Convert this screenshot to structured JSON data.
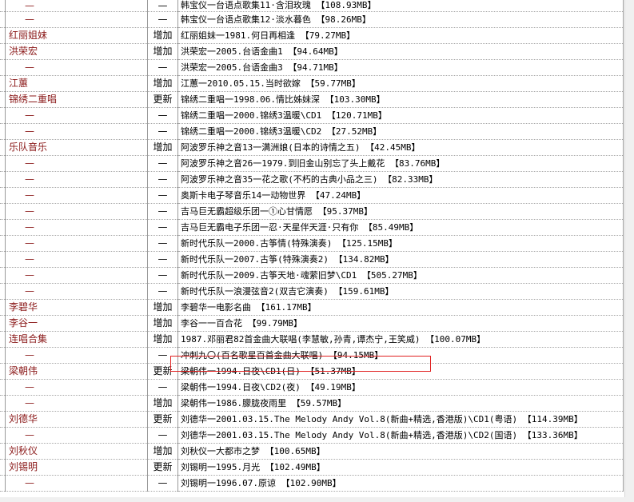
{
  "rows": [
    {
      "artist": "—",
      "action": "—",
      "text": "韩宝仪一台语点歌集11·含泪玫瑰  【108.93MB】"
    },
    {
      "artist": "—",
      "action": "—",
      "text": "韩宝仪一台语点歌集12·淡水暮色  【98.26MB】"
    },
    {
      "artist": "红丽姐妹",
      "action": "增加",
      "text": "红丽姐妹一1981.何日再相逢  【79.27MB】"
    },
    {
      "artist": "洪荣宏",
      "action": "增加",
      "text": "洪荣宏一2005.台语金曲1  【94.64MB】"
    },
    {
      "artist": "—",
      "action": "—",
      "text": "洪荣宏一2005.台语金曲3  【94.71MB】"
    },
    {
      "artist": "江蕙",
      "action": "增加",
      "text": "江蕙一2010.05.15.当时欲嫁  【59.77MB】"
    },
    {
      "artist": "锦绣二重唱",
      "action": "更新",
      "text": "锦绣二重唱一1998.06.情比姊妹深  【103.30MB】"
    },
    {
      "artist": "—",
      "action": "—",
      "text": "锦绣二重唱一2000.锦绣3温暖\\CD1  【120.71MB】"
    },
    {
      "artist": "—",
      "action": "—",
      "text": "锦绣二重唱一2000.锦绣3温暖\\CD2  【27.52MB】"
    },
    {
      "artist": "乐队音乐",
      "action": "增加",
      "text": "阿波罗乐神之音13一满洲娘(日本的诗情之五)  【42.45MB】"
    },
    {
      "artist": "—",
      "action": "—",
      "text": "阿波罗乐神之音26一1979.到旧金山别忘了头上戴花  【83.76MB】"
    },
    {
      "artist": "—",
      "action": "—",
      "text": "阿波罗乐神之音35一花之歌(不朽的古典小品之三)  【82.33MB】"
    },
    {
      "artist": "—",
      "action": "—",
      "text": "奥斯卡电子琴音乐14一动物世界  【47.24MB】"
    },
    {
      "artist": "—",
      "action": "—",
      "text": "吉马巨无霸超级乐团一①心甘情愿  【95.37MB】"
    },
    {
      "artist": "—",
      "action": "—",
      "text": "吉马巨无霸电子乐团一忍·天星伴天涯·只有你  【85.49MB】"
    },
    {
      "artist": "—",
      "action": "—",
      "text": "新时代乐队一2000.古筝情(特殊演奏)  【125.15MB】"
    },
    {
      "artist": "—",
      "action": "—",
      "text": "新时代乐队一2007.古筝(特殊演奏2)  【134.82MB】"
    },
    {
      "artist": "—",
      "action": "—",
      "text": "新时代乐队一2009.古筝天地·魂萦旧梦\\CD1  【505.27MB】"
    },
    {
      "artist": "—",
      "action": "—",
      "text": "新时代乐队一浪漫弦音2(双吉它演奏)  【159.61MB】"
    },
    {
      "artist": "李碧华",
      "action": "增加",
      "text": "李碧华一电影名曲  【161.17MB】"
    },
    {
      "artist": "李谷一",
      "action": "增加",
      "text": "李谷一一百合花  【99.79MB】"
    },
    {
      "artist": "连唱合集",
      "action": "增加",
      "text": "1987.邓丽君82首金曲大联唱(李慧敏,孙青,谭杰宁,王笑威)  【100.07MB】"
    },
    {
      "artist": "—",
      "action": "—",
      "text": "冲刺九〇(百名歌星百首金曲大联唱)  【94.15MB】"
    },
    {
      "artist": "梁朝伟",
      "action": "更新",
      "text": "梁朝伟一1994.日夜\\CD1(日)  【51.37MB】"
    },
    {
      "artist": "—",
      "action": "—",
      "text": "梁朝伟一1994.日夜\\CD2(夜)  【49.19MB】"
    },
    {
      "artist": "—",
      "action": "增加",
      "text": "梁朝伟一1986.朦胧夜雨里  【59.57MB】"
    },
    {
      "artist": "刘德华",
      "action": "更新",
      "text": "刘德华一2001.03.15.The Melody Andy Vol.8(新曲+精选,香港版)\\CD1(粤语)  【114.39MB】"
    },
    {
      "artist": "—",
      "action": "—",
      "text": "刘德华一2001.03.15.The Melody Andy Vol.8(新曲+精选,香港版)\\CD2(国语)  【133.36MB】"
    },
    {
      "artist": "刘秋仪",
      "action": "增加",
      "text": "刘秋仪一大都市之梦  【100.65MB】"
    },
    {
      "artist": "刘锡明",
      "action": "更新",
      "text": "刘锡明一1995.月光  【102.49MB】"
    },
    {
      "artist": "—",
      "action": "—",
      "text": "刘锡明一1996.07.原谅  【102.90MB】"
    }
  ]
}
